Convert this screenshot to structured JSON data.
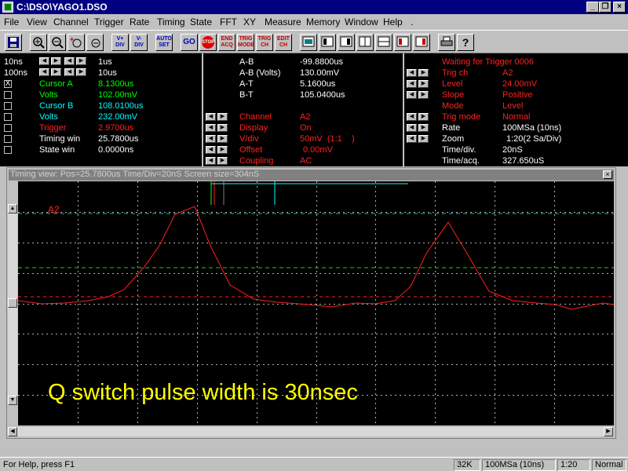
{
  "window": {
    "title": "C:\\DSO\\YAGO1.DSO",
    "minimize": "_",
    "restore": "❐",
    "close": "×"
  },
  "menu": [
    "File",
    "View",
    "Channel",
    "Trigger",
    "Rate",
    "Timing",
    "State",
    "FFT",
    "XY",
    "Measure",
    "Memory",
    "Window",
    "Help",
    "."
  ],
  "toolbar": {
    "plus_div": "V+\nDIV",
    "minus_div": "V-\nDIV",
    "auto_set": "AUTO\nSET",
    "go": "GO",
    "stop": "STOP",
    "end_acq": "END\nACQ",
    "trig_mode": "TRIG\nMODE",
    "trig_ch": "TRIG\nCH",
    "edit_ch": "EDIT\nCH",
    "help": "?"
  },
  "col1": {
    "rows": [
      {
        "left": "10ns",
        "value": "1us"
      },
      {
        "left": "100ns",
        "value": "10us"
      }
    ],
    "items": [
      {
        "label": "Cursor A",
        "value": "8.1300us",
        "color": "#00ff00",
        "checked": "X"
      },
      {
        "label": "Volts",
        "value": "102.00mV",
        "color": "#00ff00",
        "checked": ""
      },
      {
        "label": "Cursor B",
        "value": "108.0100us",
        "color": "#00ffff",
        "checked": ""
      },
      {
        "label": "Volts",
        "value": "232.00mV",
        "color": "#00ffff",
        "checked": ""
      },
      {
        "label": "Trigger",
        "value": "2.9700us",
        "color": "#ff2020",
        "checked": ""
      },
      {
        "label": "Timing win",
        "value": "25.7800us",
        "color": "#ffffff",
        "checked": ""
      },
      {
        "label": "State win",
        "value": "0.0000ns",
        "color": "#ffffff",
        "checked": ""
      }
    ]
  },
  "col2": {
    "measures": [
      {
        "label": "A-B",
        "value": "-99.8800us"
      },
      {
        "label": "A-B (Volts)",
        "value": "130.00mV"
      },
      {
        "label": "A-T",
        "value": "5.1600us"
      },
      {
        "label": "B-T",
        "value": "105.0400us"
      }
    ],
    "channel": [
      {
        "label": "Channel",
        "value": "A2"
      },
      {
        "label": "Display",
        "value": "On"
      },
      {
        "label": "V/div",
        "value": "50mV  (1:1    )"
      },
      {
        "label": "Offset",
        "value": "0.00mV"
      },
      {
        "label": "Coupling",
        "value": "AC"
      }
    ]
  },
  "col3": {
    "status": "Waiting for Trigger 0006",
    "trigger": [
      {
        "label": "Trig ch",
        "value": "A2"
      },
      {
        "label": "Level",
        "value": "24.00mV"
      },
      {
        "label": "Slope",
        "value": "Positive"
      },
      {
        "label": "Mode",
        "value": "Level"
      },
      {
        "label": "Trig mode",
        "value": "Normal"
      }
    ],
    "rate": [
      {
        "label": "Rate",
        "value": "100MSa (10ns)"
      },
      {
        "label": "Zoom",
        "value": "1:20(2 Sa/Div)"
      },
      {
        "label": "Time/div.",
        "value": "20nS"
      },
      {
        "label": "Time/acq.",
        "value": "327.650uS"
      }
    ]
  },
  "timing_window": {
    "title": "Timing view: Pos=25.7800us Time/Div=20nS Screen size=304nS",
    "channel_marker": "A2",
    "annotation": "Q switch pulse width is 30nsec"
  },
  "colors": {
    "trace": "#ff2020",
    "grid": "#b0b0b0",
    "cursor_a": "#00ff00",
    "cursor_b": "#00ffff",
    "trigger": "#ff2020",
    "annotation": "#ffff00",
    "red_label": "#ff2020",
    "white_text": "#ffffff"
  },
  "statusbar": {
    "help": "For Help, press F1",
    "memory": "32K",
    "rate": "100MSa (10ns)",
    "zoom": "1:20",
    "mode": "Normal"
  }
}
